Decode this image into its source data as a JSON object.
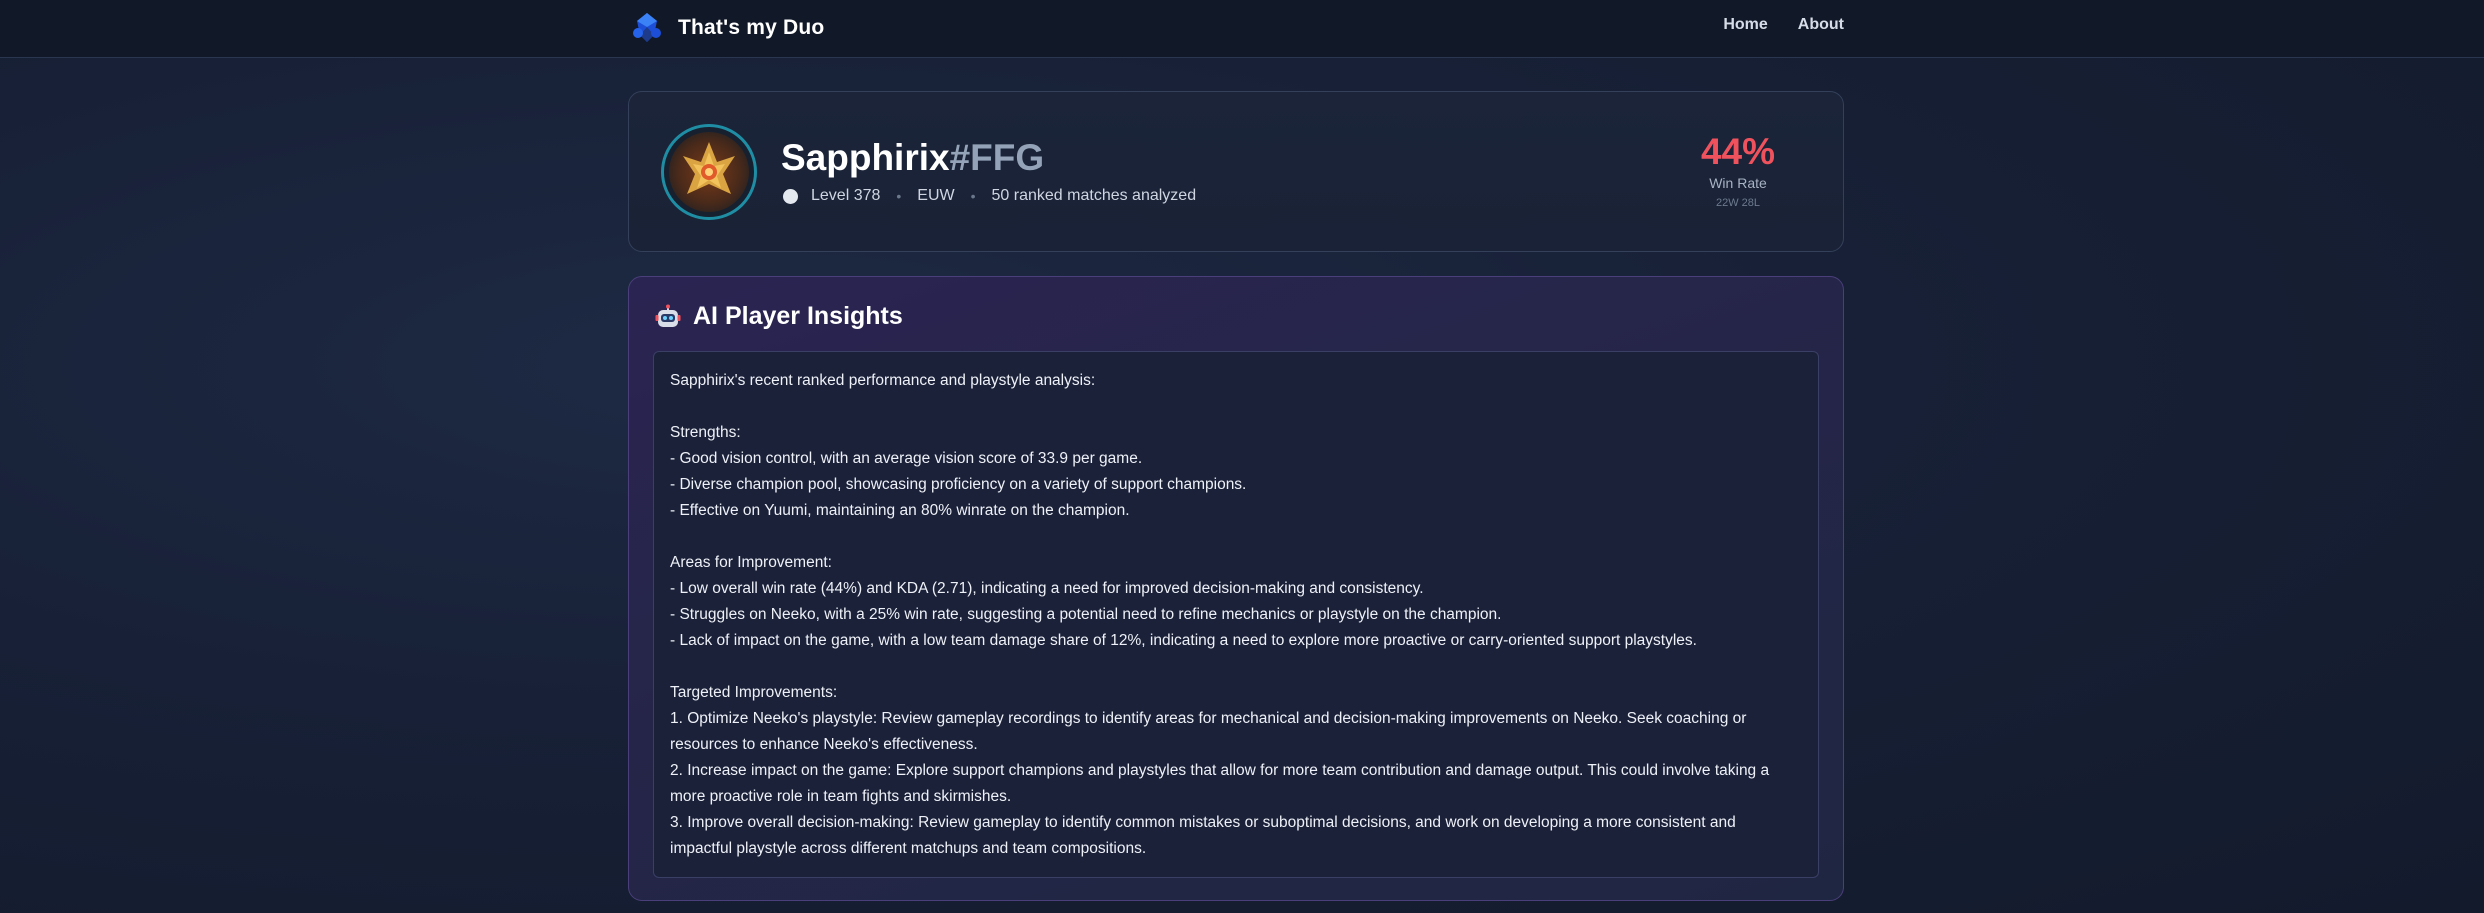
{
  "app": {
    "name": "That's my Duo",
    "logo_icon": "blue-crystal-logo-icon"
  },
  "nav": {
    "home": "Home",
    "about": "About"
  },
  "player": {
    "game_name": "Sapphirix",
    "tag": "#FFG",
    "level": "Level 378",
    "region": "EUW",
    "matches": "50 ranked matches analyzed",
    "win_rate": "44%",
    "win_rate_label": "Win Rate",
    "record": "22W 28L",
    "avatar_icon": "profile-emblem-icon",
    "accent": "#f0525d",
    "ring": "#1f8ea4"
  },
  "insights": {
    "icon": "robot-icon",
    "title": "AI Player Insights",
    "text": "Sapphirix's recent ranked performance and playstyle analysis:\n\nStrengths:\n- Good vision control, with an average vision score of 33.9 per game.\n- Diverse champion pool, showcasing proficiency on a variety of support champions.\n- Effective on Yuumi, maintaining an 80% winrate on the champion.\n\nAreas for Improvement:\n- Low overall win rate (44%) and KDA (2.71), indicating a need for improved decision-making and consistency.\n- Struggles on Neeko, with a 25% win rate, suggesting a potential need to refine mechanics or playstyle on the champion.\n- Lack of impact on the game, with a low team damage share of 12%, indicating a need to explore more proactive or carry-oriented support playstyles.\n\nTargeted Improvements:\n1. Optimize Neeko's playstyle: Review gameplay recordings to identify areas for mechanical and decision-making improvements on Neeko. Seek coaching or resources to enhance Neeko's effectiveness.\n2. Increase impact on the game: Explore support champions and playstyles that allow for more team contribution and damage output. This could involve taking a more proactive role in team fights and skirmishes.\n3. Improve overall decision-making: Review gameplay to identify common mistakes or suboptimal decisions, and work on developing a more consistent and impactful playstyle across different matchups and team compositions."
  }
}
